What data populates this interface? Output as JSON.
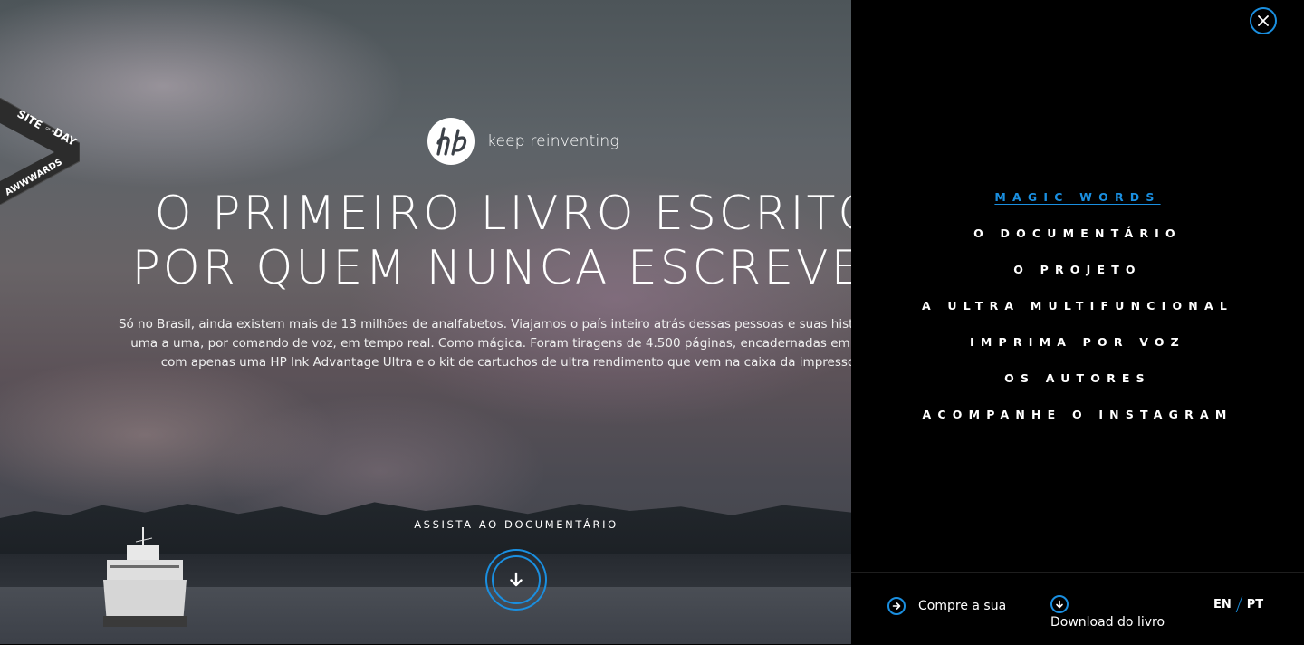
{
  "hero": {
    "brand": {
      "tagline": "keep reinventing"
    },
    "headline": {
      "line1": "O PRIMEIRO LIVRO ESCRITO",
      "line2": "POR QUEM NUNCA ESCREVEU"
    },
    "intro": {
      "line1": "Só no Brasil, ainda existem mais de 13 milhões de analfabetos. Viajamos o país inteiro atrás dessas pessoas e suas histórias e im",
      "line2": "uma a uma, por comando de voz, em tempo real. Como mágica. Foram tiragens de 4.500 páginas, encadernadas em livros. T",
      "line3": "com apenas uma HP Ink Advantage Ultra e o kit de cartuchos de ultra rendimento que vem na caixa da impressora."
    },
    "cta_label": "ASSISTA AO DOCUMENTÁRIO"
  },
  "badge": {
    "line1": "SITE",
    "line2": "DAY",
    "small": "OF THE",
    "brand": "AWWWARDS"
  },
  "menu": {
    "items": [
      {
        "label": "MAGIC WORDS",
        "active": true
      },
      {
        "label": "O DOCUMENTÁRIO"
      },
      {
        "label": "O PROJETO"
      },
      {
        "label": "A ULTRA MULTIFUNCIONAL"
      },
      {
        "label": "IMPRIMA POR VOZ"
      },
      {
        "label": "OS AUTORES"
      },
      {
        "label": "ACOMPANHE O INSTAGRAM"
      }
    ]
  },
  "footer": {
    "buy_label": "Compre a sua",
    "download_label": "Download do livro",
    "lang_en": "EN",
    "lang_pt": "PT"
  },
  "colors": {
    "accent": "#1a8fe0",
    "panel_bg": "#000000",
    "text": "#ffffff"
  },
  "icons": {
    "close": "close-icon",
    "arrow_down": "arrow-down-icon",
    "arrow_right": "arrow-right-icon"
  }
}
